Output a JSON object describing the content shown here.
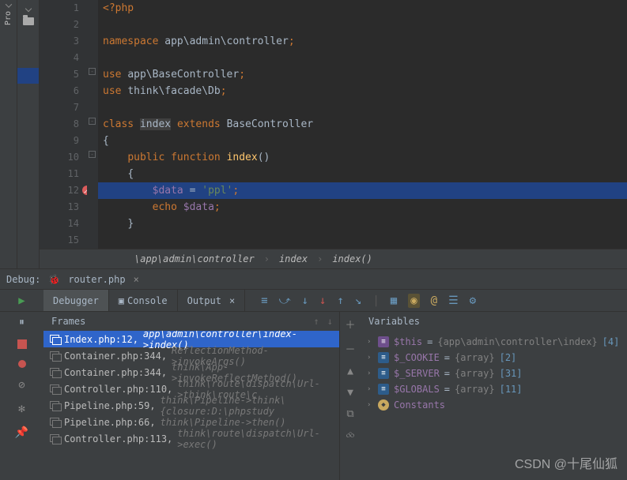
{
  "sidebar": {
    "project_label": "Pro"
  },
  "editor": {
    "lines": [
      "1",
      "2",
      "3",
      "4",
      "5",
      "6",
      "7",
      "8",
      "9",
      "10",
      "11",
      "12",
      "13",
      "14",
      "15"
    ],
    "code": {
      "l1_open": "<?php",
      "l3_ns": "namespace",
      "l3_path": "app\\admin\\controller",
      "l5_use": "use",
      "l5_cls": "app\\BaseController",
      "l6_use": "use",
      "l6_cls": "think\\facade\\Db",
      "l8_class": "class",
      "l8_name": "index",
      "l8_ext": "extends",
      "l8_base": "BaseController",
      "l9_brace": "{",
      "l10_pub": "public",
      "l10_fn": "function",
      "l10_name": "index",
      "l10_par": "()",
      "l11_brace": "{",
      "l12_var": "$data",
      "l12_eq": " = ",
      "l12_str": "'ppl'",
      "l12_semi": ";",
      "l13_echo": "echo",
      "l13_var": "$data",
      "l13_semi": ";",
      "l14_brace": "}"
    }
  },
  "breadcrumb": {
    "p1": "\\app\\admin\\controller",
    "p2": "index",
    "p3": "index()"
  },
  "debug": {
    "label": "Debug:",
    "file": "router.php",
    "tabs": {
      "debugger": "Debugger",
      "console": "Console",
      "output": "Output"
    },
    "frames_title": "Frames",
    "vars_title": "Variables"
  },
  "frames": [
    {
      "loc": "Index.php:12,",
      "call": "app\\admin\\controller\\index->index()"
    },
    {
      "loc": "Container.php:344,",
      "call": "ReflectionMethod->invokeArgs()"
    },
    {
      "loc": "Container.php:344,",
      "call": "think\\App->invokeReflectMethod()"
    },
    {
      "loc": "Controller.php:110,",
      "call": "think\\route\\dispatch\\Url->think\\route\\c"
    },
    {
      "loc": "Pipeline.php:59,",
      "call": "think\\Pipeline->think\\{closure:D:\\phpstudy"
    },
    {
      "loc": "Pipeline.php:66,",
      "call": "think\\Pipeline->then()"
    },
    {
      "loc": "Controller.php:113,",
      "call": "think\\route\\dispatch\\Url->exec()"
    }
  ],
  "vars": [
    {
      "name": "$this",
      "type": "{app\\admin\\controller\\index}",
      "len": "[4]",
      "badge": "obj"
    },
    {
      "name": "$_COOKIE",
      "type": "{array}",
      "len": "[2]",
      "badge": "arr"
    },
    {
      "name": "$_SERVER",
      "type": "{array}",
      "len": "[31]",
      "badge": "arr"
    },
    {
      "name": "$GLOBALS",
      "type": "{array}",
      "len": "[11]",
      "badge": "arr"
    },
    {
      "name": "Constants",
      "type": "",
      "len": "",
      "badge": "const"
    }
  ],
  "watermark": "CSDN @十尾仙狐"
}
